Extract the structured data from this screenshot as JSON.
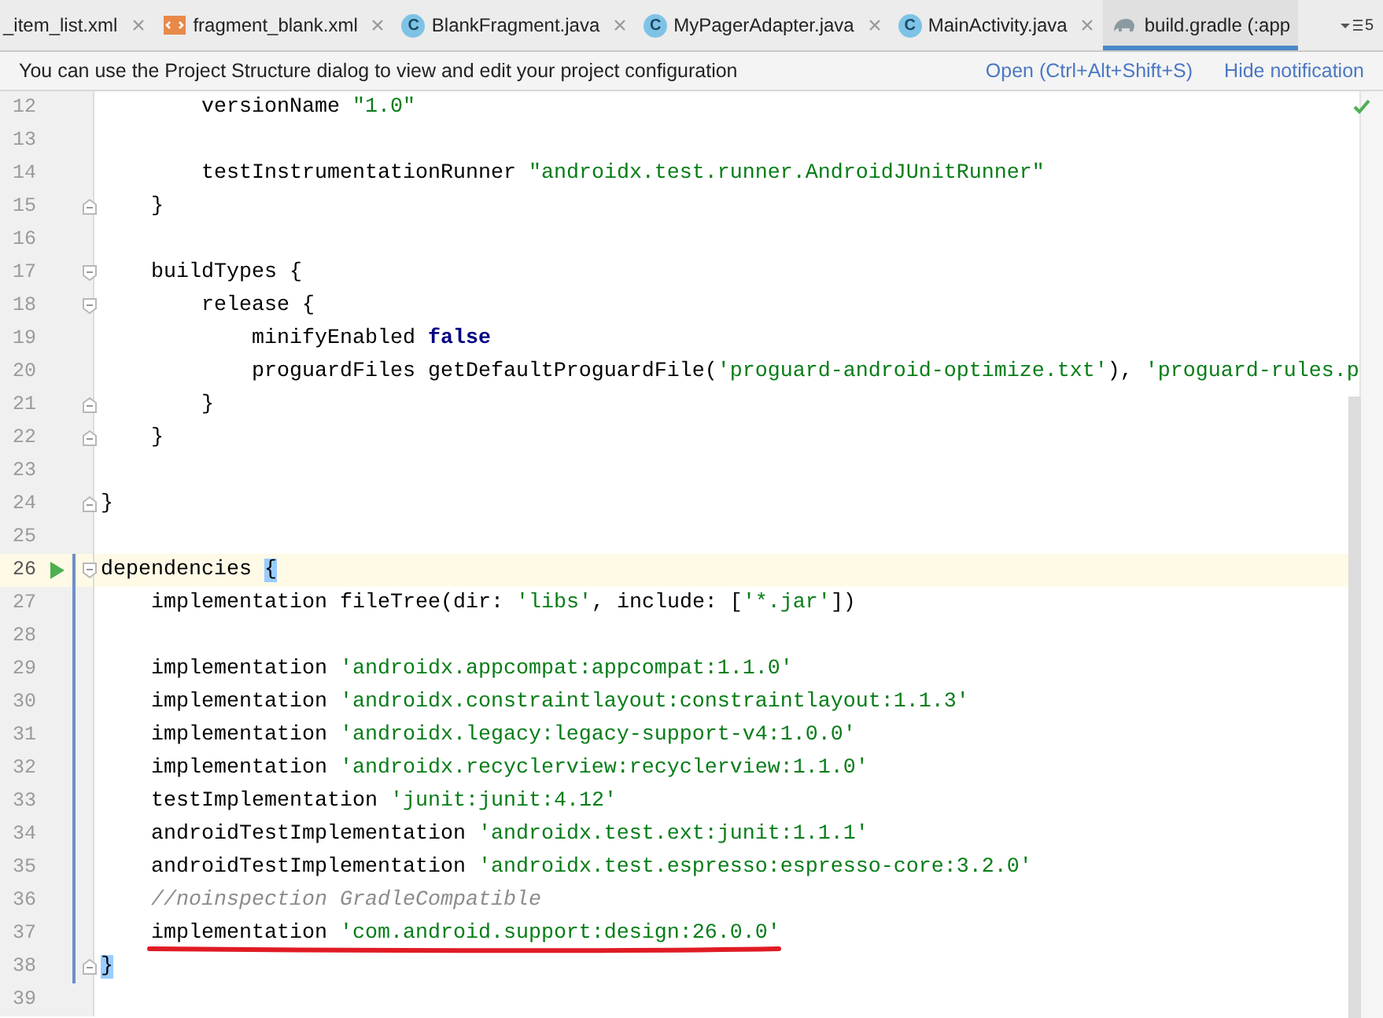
{
  "tabs": [
    {
      "label": "_item_list.xml",
      "kind": "none",
      "selected": false,
      "closable": true
    },
    {
      "label": "fragment_blank.xml",
      "kind": "xml",
      "selected": false,
      "closable": true
    },
    {
      "label": "BlankFragment.java",
      "kind": "class",
      "badge": "C",
      "selected": false,
      "closable": true
    },
    {
      "label": "MyPagerAdapter.java",
      "kind": "class",
      "badge": "C",
      "selected": false,
      "closable": true
    },
    {
      "label": "MainActivity.java",
      "kind": "class",
      "badge": "C",
      "selected": false,
      "closable": true
    },
    {
      "label": "build.gradle (:app",
      "kind": "gradle",
      "selected": true,
      "closable": false
    }
  ],
  "tab_overflow": {
    "count": "5"
  },
  "notification": {
    "message": "You can use the Project Structure dialog to view and edit your project configuration",
    "actions": [
      "Open (Ctrl+Alt+Shift+S)",
      "Hide notification"
    ]
  },
  "inspection_ok": true,
  "lines": [
    {
      "number": "12",
      "segments": [
        {
          "kind": "plain",
          "text": "        versionName "
        },
        {
          "kind": "string",
          "text": "\"1.0\""
        }
      ],
      "current": false,
      "changed": false,
      "fold_start": false,
      "fold_end": false,
      "run": false,
      "underlined": false
    },
    {
      "number": "13",
      "current": false,
      "changed": false,
      "fold_start": false,
      "fold_end": false,
      "run": false,
      "underlined": false
    },
    {
      "number": "14",
      "segments": [
        {
          "kind": "plain",
          "text": "        testInstrumentationRunner "
        },
        {
          "kind": "string",
          "text": "\"androidx.test.runner.AndroidJUnitRunner\""
        }
      ],
      "current": false,
      "changed": false,
      "fold_start": false,
      "fold_end": false,
      "run": false,
      "underlined": false
    },
    {
      "number": "15",
      "segments": [
        {
          "kind": "plain",
          "text": "    }"
        }
      ],
      "current": false,
      "changed": false,
      "fold_start": false,
      "fold_end": true,
      "run": false,
      "underlined": false
    },
    {
      "number": "16",
      "current": false,
      "changed": false,
      "fold_start": false,
      "fold_end": false,
      "run": false,
      "underlined": false
    },
    {
      "number": "17",
      "segments": [
        {
          "kind": "plain",
          "text": "    buildTypes {"
        }
      ],
      "current": false,
      "changed": false,
      "fold_start": true,
      "fold_end": false,
      "run": false,
      "underlined": false
    },
    {
      "number": "18",
      "segments": [
        {
          "kind": "plain",
          "text": "        release {"
        }
      ],
      "current": false,
      "changed": false,
      "fold_start": true,
      "fold_end": false,
      "run": false,
      "underlined": false
    },
    {
      "number": "19",
      "segments": [
        {
          "kind": "plain",
          "text": "            minifyEnabled "
        },
        {
          "kind": "keyword",
          "text": "false"
        }
      ],
      "current": false,
      "changed": false,
      "fold_start": false,
      "fold_end": false,
      "run": false,
      "underlined": false
    },
    {
      "number": "20",
      "segments": [
        {
          "kind": "plain",
          "text": "            proguardFiles getDefaultProguardFile("
        },
        {
          "kind": "string",
          "text": "'proguard-android-optimize.txt'"
        },
        {
          "kind": "plain",
          "text": "), "
        },
        {
          "kind": "string",
          "text": "'proguard-rules.p"
        }
      ],
      "current": false,
      "changed": false,
      "fold_start": false,
      "fold_end": false,
      "run": false,
      "underlined": false
    },
    {
      "number": "21",
      "segments": [
        {
          "kind": "plain",
          "text": "        }"
        }
      ],
      "current": false,
      "changed": false,
      "fold_start": false,
      "fold_end": true,
      "run": false,
      "underlined": false
    },
    {
      "number": "22",
      "segments": [
        {
          "kind": "plain",
          "text": "    }"
        }
      ],
      "current": false,
      "changed": false,
      "fold_start": false,
      "fold_end": true,
      "run": false,
      "underlined": false
    },
    {
      "number": "23",
      "current": false,
      "changed": false,
      "fold_start": false,
      "fold_end": false,
      "run": false,
      "underlined": false
    },
    {
      "number": "24",
      "segments": [
        {
          "kind": "plain",
          "text": "}"
        }
      ],
      "current": false,
      "changed": false,
      "fold_start": false,
      "fold_end": true,
      "run": false,
      "underlined": false
    },
    {
      "number": "25",
      "current": false,
      "changed": false,
      "fold_start": false,
      "fold_end": false,
      "run": false,
      "underlined": false
    },
    {
      "number": "26",
      "segments": [
        {
          "kind": "plain",
          "text": "dependencies "
        },
        {
          "kind": "brace",
          "text": "{"
        }
      ],
      "current": true,
      "changed": true,
      "fold_start": true,
      "fold_end": false,
      "run": true,
      "underlined": false
    },
    {
      "number": "27",
      "segments": [
        {
          "kind": "plain",
          "text": "    implementation fileTree(dir: "
        },
        {
          "kind": "string",
          "text": "'libs'"
        },
        {
          "kind": "plain",
          "text": ", include: ["
        },
        {
          "kind": "string",
          "text": "'*.jar'"
        },
        {
          "kind": "plain",
          "text": "])"
        }
      ],
      "current": false,
      "changed": true,
      "fold_start": false,
      "fold_end": false,
      "run": false,
      "underlined": false
    },
    {
      "number": "28",
      "current": false,
      "changed": true,
      "fold_start": false,
      "fold_end": false,
      "run": false,
      "underlined": false
    },
    {
      "number": "29",
      "segments": [
        {
          "kind": "plain",
          "text": "    implementation "
        },
        {
          "kind": "string",
          "text": "'androidx.appcompat:appcompat:1.1.0'"
        }
      ],
      "current": false,
      "changed": true,
      "fold_start": false,
      "fold_end": false,
      "run": false,
      "underlined": false
    },
    {
      "number": "30",
      "segments": [
        {
          "kind": "plain",
          "text": "    implementation "
        },
        {
          "kind": "string",
          "text": "'androidx.constraintlayout:constraintlayout:1.1.3'"
        }
      ],
      "current": false,
      "changed": true,
      "fold_start": false,
      "fold_end": false,
      "run": false,
      "underlined": false
    },
    {
      "number": "31",
      "segments": [
        {
          "kind": "plain",
          "text": "    implementation "
        },
        {
          "kind": "string",
          "text": "'androidx.legacy:legacy-support-v4:1.0.0'"
        }
      ],
      "current": false,
      "changed": true,
      "fold_start": false,
      "fold_end": false,
      "run": false,
      "underlined": false
    },
    {
      "number": "32",
      "segments": [
        {
          "kind": "plain",
          "text": "    implementation "
        },
        {
          "kind": "string",
          "text": "'androidx.recyclerview:recyclerview:1.1.0'"
        }
      ],
      "current": false,
      "changed": true,
      "fold_start": false,
      "fold_end": false,
      "run": false,
      "underlined": false
    },
    {
      "number": "33",
      "segments": [
        {
          "kind": "plain",
          "text": "    testImplementation "
        },
        {
          "kind": "string",
          "text": "'junit:junit:4.12'"
        }
      ],
      "current": false,
      "changed": true,
      "fold_start": false,
      "fold_end": false,
      "run": false,
      "underlined": false
    },
    {
      "number": "34",
      "segments": [
        {
          "kind": "plain",
          "text": "    androidTestImplementation "
        },
        {
          "kind": "string",
          "text": "'androidx.test.ext:junit:1.1.1'"
        }
      ],
      "current": false,
      "changed": true,
      "fold_start": false,
      "fold_end": false,
      "run": false,
      "underlined": false
    },
    {
      "number": "35",
      "segments": [
        {
          "kind": "plain",
          "text": "    androidTestImplementation "
        },
        {
          "kind": "string",
          "text": "'androidx.test.espresso:espresso-core:3.2.0'"
        }
      ],
      "current": false,
      "changed": true,
      "fold_start": false,
      "fold_end": false,
      "run": false,
      "underlined": false
    },
    {
      "number": "36",
      "segments": [
        {
          "kind": "comment",
          "text": "    //noinspection GradleCompatible"
        }
      ],
      "current": false,
      "changed": true,
      "fold_start": false,
      "fold_end": false,
      "run": false,
      "underlined": false
    },
    {
      "number": "37",
      "segments": [
        {
          "kind": "plain",
          "text": "    implementation "
        },
        {
          "kind": "string",
          "text": "'com.android.support:design:26.0.0'"
        }
      ],
      "current": false,
      "changed": true,
      "fold_start": false,
      "fold_end": false,
      "run": false,
      "underlined": true
    },
    {
      "number": "38",
      "segments": [
        {
          "kind": "brace",
          "text": "}"
        }
      ],
      "current": false,
      "changed": true,
      "fold_start": false,
      "fold_end": true,
      "run": false,
      "underlined": false
    },
    {
      "number": "39",
      "current": false,
      "changed": false,
      "fold_start": false,
      "fold_end": false,
      "run": false,
      "underlined": false
    }
  ]
}
